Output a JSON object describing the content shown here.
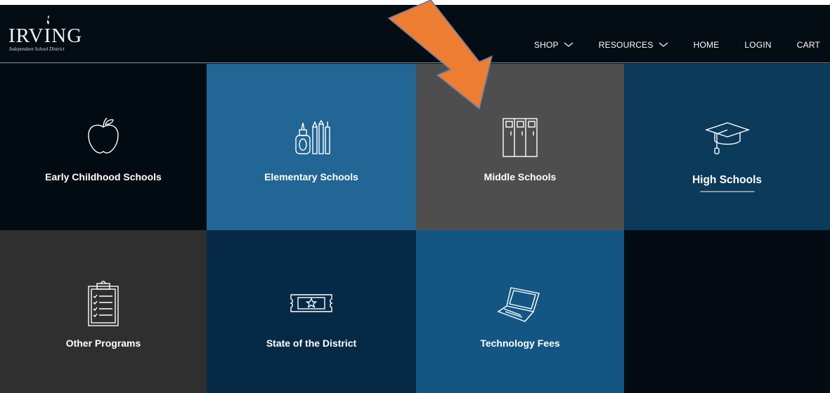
{
  "header": {
    "logo": {
      "word": "IRVING",
      "subtitle": "Independent School District"
    },
    "nav": [
      {
        "label": "SHOP",
        "has_dropdown": true
      },
      {
        "label": "RESOURCES",
        "has_dropdown": true
      },
      {
        "label": "HOME",
        "has_dropdown": false
      },
      {
        "label": "LOGIN",
        "has_dropdown": false
      },
      {
        "label": "CART",
        "has_dropdown": false
      }
    ]
  },
  "tiles": [
    {
      "label": "Early Childhood Schools",
      "icon": "apple-icon",
      "color": "#030b12"
    },
    {
      "label": "Elementary Schools",
      "icon": "school-supplies-icon",
      "color": "#216694"
    },
    {
      "label": "Middle Schools",
      "icon": "lockers-icon",
      "color": "#4e4e4e"
    },
    {
      "label": "High Schools",
      "icon": "graduation-cap-icon",
      "color": "#0b3a5a",
      "active": true
    },
    {
      "label": "Other Programs",
      "icon": "clipboard-icon",
      "color": "#2f2f2f"
    },
    {
      "label": "State of the District",
      "icon": "ticket-star-icon",
      "color": "#062a46"
    },
    {
      "label": "Technology Fees",
      "icon": "laptop-icon",
      "color": "#145683"
    }
  ],
  "colors": {
    "annotation_arrow": "#ed7d31",
    "header_bg": "#040c14"
  }
}
